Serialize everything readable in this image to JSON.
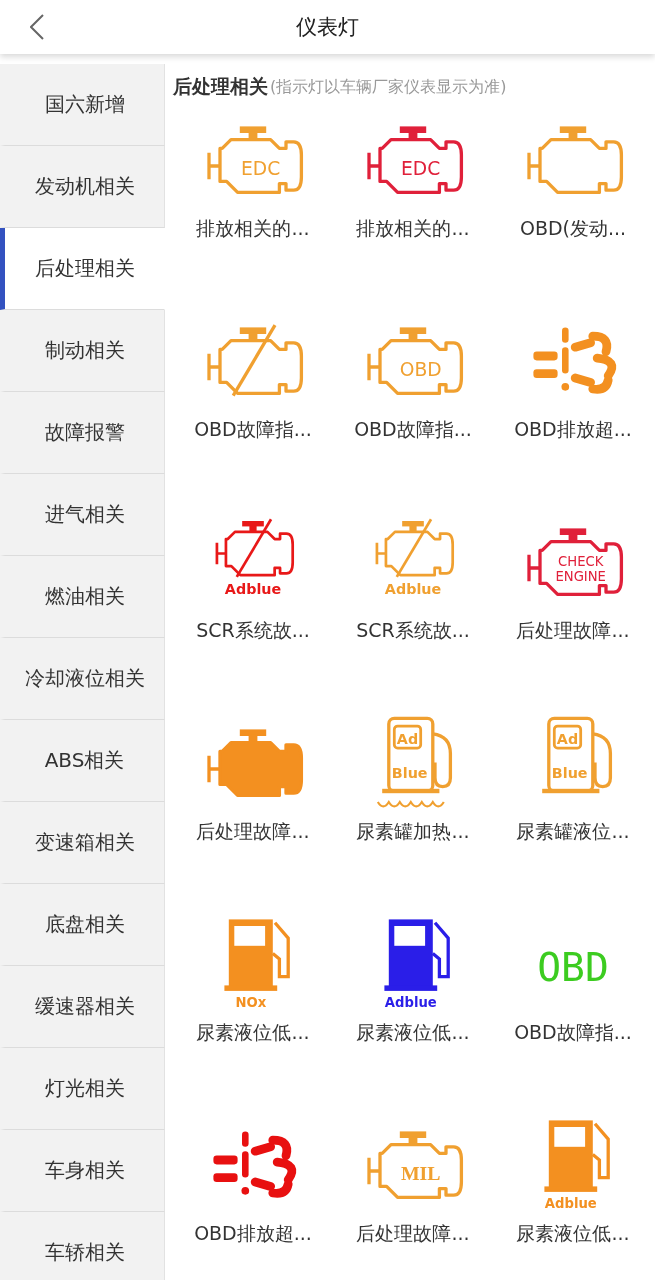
{
  "header": {
    "title": "仪表灯"
  },
  "sidebar": {
    "items": [
      {
        "label": "国六新增",
        "selected": false
      },
      {
        "label": "发动机相关",
        "selected": false
      },
      {
        "label": "后处理相关",
        "selected": true
      },
      {
        "label": "制动相关",
        "selected": false
      },
      {
        "label": "故障报警",
        "selected": false
      },
      {
        "label": "进气相关",
        "selected": false
      },
      {
        "label": "燃油相关",
        "selected": false
      },
      {
        "label": "冷却液位相关",
        "selected": false
      },
      {
        "label": "ABS相关",
        "selected": false
      },
      {
        "label": "变速箱相关",
        "selected": false
      },
      {
        "label": "底盘相关",
        "selected": false
      },
      {
        "label": "缓速器相关",
        "selected": false
      },
      {
        "label": "灯光相关",
        "selected": false
      },
      {
        "label": "车身相关",
        "selected": false
      },
      {
        "label": "车轿相关",
        "selected": false
      }
    ]
  },
  "section": {
    "title": "后处理相关",
    "note": "(指示灯以车辆厂家仪表显示为准)"
  },
  "lights": [
    {
      "label": "排放相关的...",
      "icon": {
        "kind": "engine",
        "color": "#f0a030",
        "text": [
          "EDC"
        ],
        "slashed": false
      }
    },
    {
      "label": "排放相关的...",
      "icon": {
        "kind": "engine",
        "color": "#e0203a",
        "text": [
          "EDC"
        ],
        "slashed": false
      }
    },
    {
      "label": "OBD(发动...",
      "icon": {
        "kind": "engine",
        "color": "#f0a030",
        "slashed": false
      }
    },
    {
      "label": "OBD故障指...",
      "icon": {
        "kind": "engine",
        "color": "#f0a030",
        "slashed": true
      }
    },
    {
      "label": "OBD故障指...",
      "icon": {
        "kind": "engine",
        "color": "#f0a030",
        "text": [
          "OBD"
        ],
        "slashed": false
      }
    },
    {
      "label": "OBD排放超...",
      "icon": {
        "kind": "exhaust",
        "color": "#f39020"
      }
    },
    {
      "label": "SCR系统故...",
      "icon": {
        "kind": "engine",
        "color": "#e81818",
        "slashed": true,
        "caption": "Adblue"
      }
    },
    {
      "label": "SCR系统故...",
      "icon": {
        "kind": "engine",
        "color": "#f0a030",
        "slashed": true,
        "caption": "Adblue"
      }
    },
    {
      "label": "后处理故障...",
      "icon": {
        "kind": "engine",
        "color": "#e0203a",
        "text": [
          "CHECK",
          "ENGINE"
        ],
        "slashed": false
      }
    },
    {
      "label": "后处理故障...",
      "icon": {
        "kind": "engine-filled",
        "color": "#f39020"
      }
    },
    {
      "label": "尿素罐加热...",
      "icon": {
        "kind": "pump-outline",
        "color": "#f0a030",
        "text": [
          "Ad",
          "Blue"
        ],
        "heating": true
      }
    },
    {
      "label": "尿素罐液位...",
      "icon": {
        "kind": "pump-outline",
        "color": "#f0a030",
        "text": [
          "Ad",
          "Blue"
        ],
        "heating": false
      }
    },
    {
      "label": "尿素液位低...",
      "icon": {
        "kind": "pump-filled",
        "color": "#f39020",
        "caption": "NOx"
      }
    },
    {
      "label": "尿素液位低...",
      "icon": {
        "kind": "pump-filled",
        "color": "#2a1ee8",
        "caption": "Adblue"
      }
    },
    {
      "label": "OBD故障指...",
      "icon": {
        "kind": "text",
        "color": "#3ccc20",
        "text": [
          "OBD"
        ]
      }
    },
    {
      "label": "OBD排放超...",
      "icon": {
        "kind": "exhaust",
        "color": "#e81010"
      }
    },
    {
      "label": "后处理故障...",
      "icon": {
        "kind": "engine",
        "color": "#f0a030",
        "text": [
          "MIL"
        ],
        "slashed": false,
        "serif": true
      }
    },
    {
      "label": "尿素液位低...",
      "icon": {
        "kind": "pump-filled",
        "color": "#f39020",
        "caption": "Adblue"
      }
    }
  ]
}
